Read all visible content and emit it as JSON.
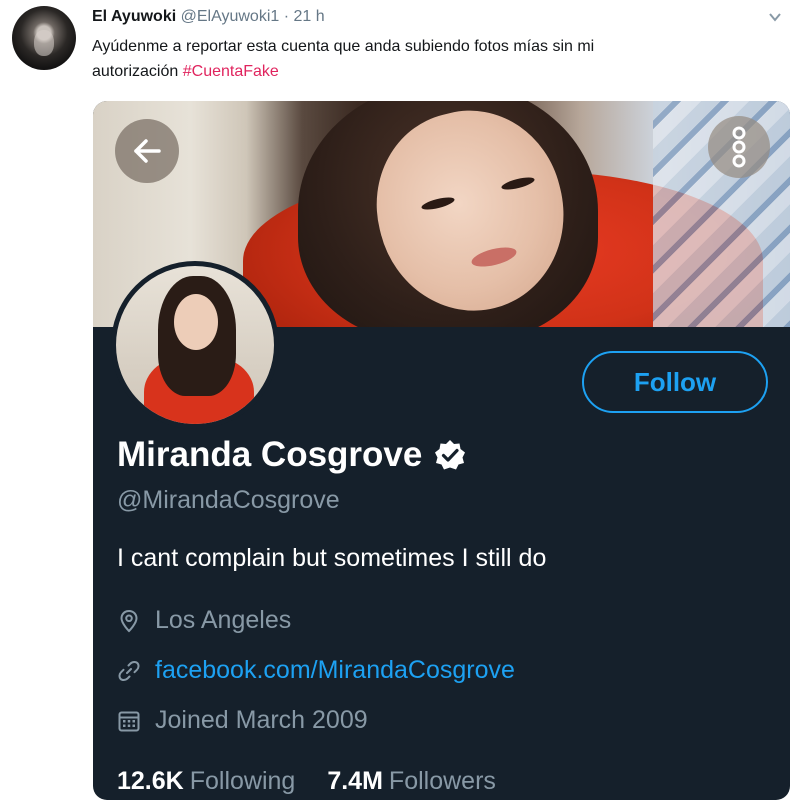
{
  "tweet": {
    "author_name": "El Ayuwoki",
    "author_handle": "@ElAyuwoki1",
    "separator": "·",
    "time": "21 h",
    "text_line1": "Ayúdenme a reportar esta cuenta que anda subiendo fotos mías sin mi",
    "text_line2": "autorización",
    "hashtag": "#CuentaFake"
  },
  "profile": {
    "display_name": "Miranda Cosgrove",
    "screen_name": "@MirandaCosgrove",
    "bio": "I cant complain but sometimes I still do",
    "location": "Los Angeles",
    "url": "facebook.com/MirandaCosgrove",
    "joined": "Joined March 2009",
    "follow_label": "Follow",
    "following_count": "12.6K",
    "following_label": "Following",
    "followers_count": "7.4M",
    "followers_label": "Followers"
  },
  "icons": {
    "caret": "chevron-down-icon",
    "back": "arrow-left-icon",
    "more": "more-vertical-icon",
    "verified": "verified-badge-icon",
    "location": "location-pin-icon",
    "link": "link-icon",
    "calendar": "calendar-icon"
  },
  "colors": {
    "accent": "#1da1f2",
    "hashtag": "#e0245e",
    "card_bg": "#15202b",
    "muted": "#8899a6"
  }
}
